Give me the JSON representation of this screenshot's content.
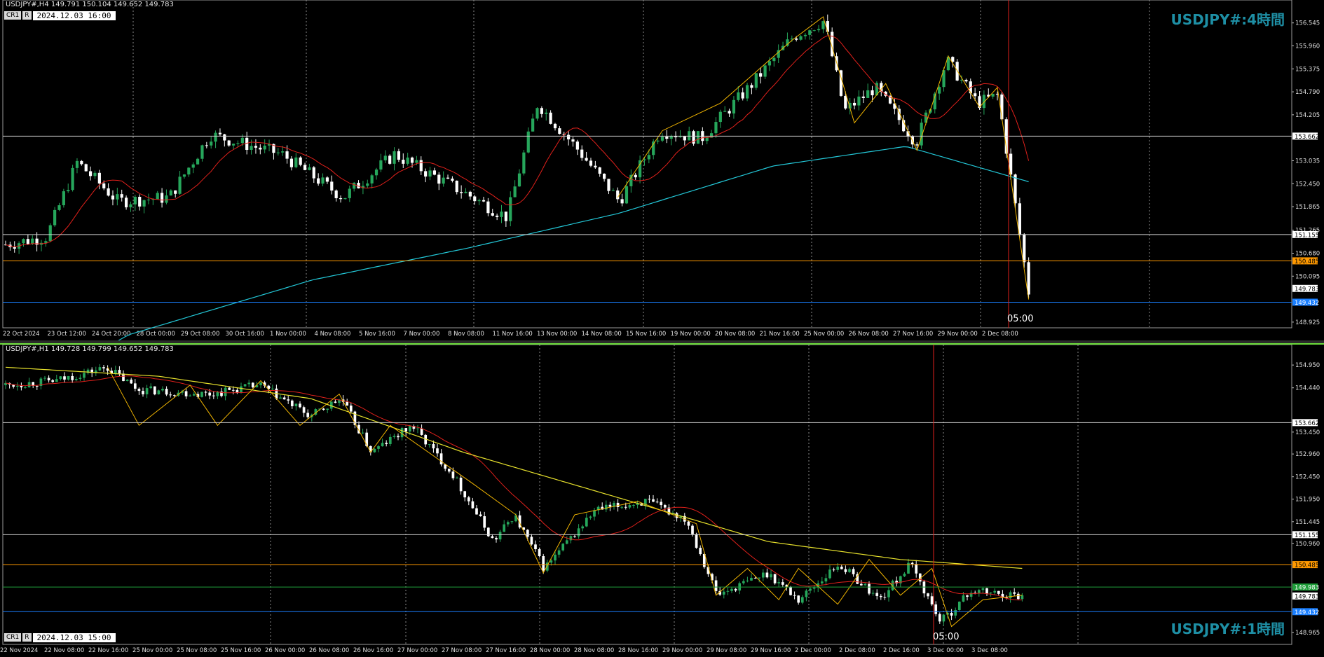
{
  "h4": {
    "info": "USDJPY#,H4  149.791 150.104 149.652 149.783",
    "box_tags": [
      "CR1",
      "R"
    ],
    "datetime": "2024.12.03 16:00",
    "watermark": "USDJPY#:4時間",
    "time_label": "05:00",
    "y_ticks": [
      "156.545",
      "155.960",
      "155.375",
      "154.790",
      "154.205",
      "153.035",
      "152.450",
      "151.865",
      "151.265",
      "150.680",
      "150.095",
      "148.925"
    ],
    "x_ticks": [
      "22 Oct 2024",
      "23 Oct 12:00",
      "24 Oct 20:00",
      "28 Oct 00:00",
      "29 Oct 08:00",
      "30 Oct 16:00",
      "1 Nov 00:00",
      "4 Nov 08:00",
      "5 Nov 16:00",
      "7 Nov 00:00",
      "8 Nov 08:00",
      "11 Nov 16:00",
      "13 Nov 00:00",
      "14 Nov 08:00",
      "15 Nov 16:00",
      "19 Nov 00:00",
      "20 Nov 08:00",
      "21 Nov 16:00",
      "25 Nov 00:00",
      "26 Nov 08:00",
      "27 Nov 16:00",
      "29 Nov 00:00",
      "2 Dec 08:00"
    ],
    "levels": [
      {
        "label": "153.662",
        "color": "#d0d0d0",
        "value": 153.662
      },
      {
        "label": "151.155",
        "color": "#d0d0d0",
        "value": 151.155
      },
      {
        "label": "150.485",
        "color": "#ff9900",
        "value": 150.485
      },
      {
        "label": "149.783",
        "color": "#ffffff",
        "value": 149.783
      },
      {
        "label": "149.432",
        "color": "#1a7fff",
        "value": 149.432
      }
    ]
  },
  "h1": {
    "info": "USDJPY#,H1  149.728 149.799 149.652 149.783",
    "box_tags": [
      "CR1",
      "R"
    ],
    "datetime": "2024.12.03 15:00",
    "watermark": "USDJPY#:1時間",
    "time_label": "05:00",
    "y_ticks": [
      "154.950",
      "154.440",
      "153.450",
      "152.960",
      "152.450",
      "151.950",
      "151.445",
      "150.960",
      "148.965"
    ],
    "x_ticks": [
      "22 Nov 2024",
      "22 Nov 08:00",
      "22 Nov 16:00",
      "25 Nov 00:00",
      "25 Nov 08:00",
      "25 Nov 16:00",
      "26 Nov 00:00",
      "26 Nov 08:00",
      "26 Nov 16:00",
      "27 Nov 00:00",
      "27 Nov 08:00",
      "27 Nov 16:00",
      "28 Nov 00:00",
      "28 Nov 08:00",
      "28 Nov 16:00",
      "29 Nov 00:00",
      "29 Nov 08:00",
      "29 Nov 16:00",
      "2 Dec 00:00",
      "2 Dec 08:00",
      "2 Dec 16:00",
      "3 Dec 00:00",
      "3 Dec 08:00"
    ],
    "levels": [
      {
        "label": "153.662",
        "color": "#d0d0d0",
        "value": 153.662
      },
      {
        "label": "151.155",
        "color": "#d0d0d0",
        "value": 151.155
      },
      {
        "label": "150.485",
        "color": "#ff9900",
        "value": 150.485
      },
      {
        "label": "149.983",
        "color": "#1f9e3a",
        "value": 149.983
      },
      {
        "label": "149.783",
        "color": "#ffffff",
        "value": 149.783
      },
      {
        "label": "149.432",
        "color": "#1a7fff",
        "value": 149.432
      }
    ]
  },
  "colors": {
    "bull": "#26a65b",
    "bear": "#ffffff",
    "ma_fast": "#e0201b",
    "ma_slow_h4": "#23c8d8",
    "ma_slow_h1": "#e6e02c",
    "zigzag": "#f0b400",
    "vline": "#e0201b"
  }
}
